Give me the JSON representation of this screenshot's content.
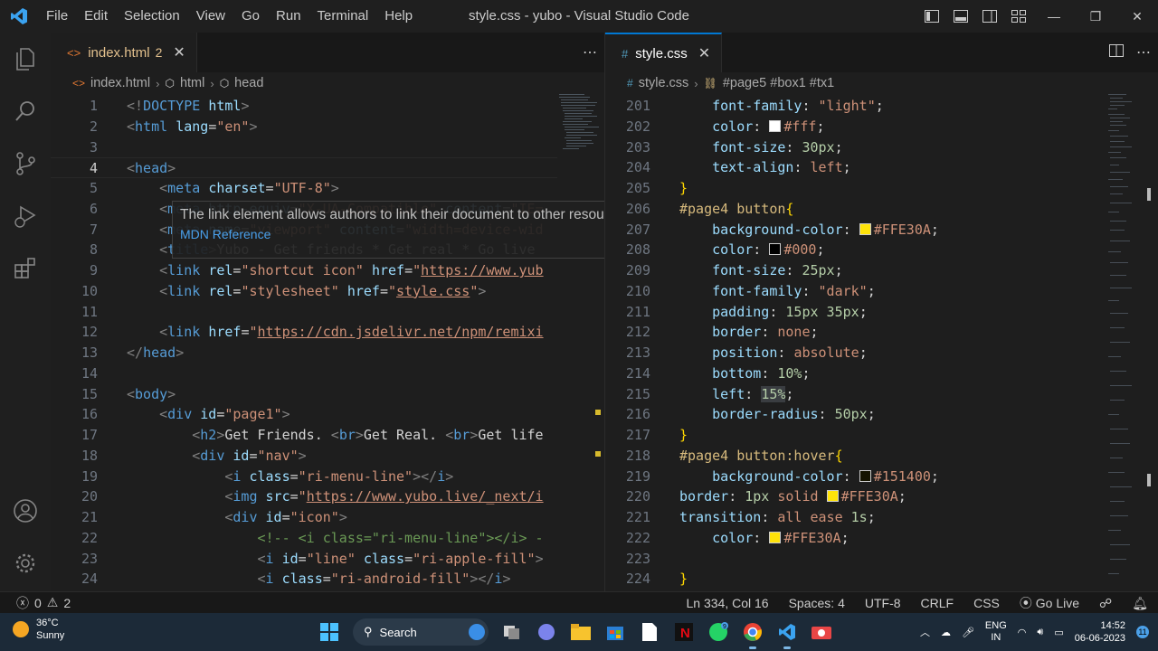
{
  "window": {
    "title": "style.css - yubo - Visual Studio Code",
    "menu": [
      "File",
      "Edit",
      "Selection",
      "View",
      "Go",
      "Run",
      "Terminal",
      "Help"
    ]
  },
  "activity": [
    "explorer-icon",
    "search-icon",
    "source-control-icon",
    "run-debug-icon",
    "extensions-icon",
    "account-icon",
    "settings-gear-icon"
  ],
  "left_editor": {
    "tab": {
      "label": "index.html",
      "problems": "2",
      "icon": "<>"
    },
    "breadcrumb": [
      "index.html",
      "html",
      "head"
    ],
    "lines": [
      {
        "n": "1",
        "html": "<span class='tag'>&lt;!</span><span class='tn'>DOCTYPE</span> <span class='an'>html</span><span class='tag'>&gt;</span>"
      },
      {
        "n": "2",
        "html": "<span class='tag'>&lt;</span><span class='tn'>html</span> <span class='an'>lang</span><span class='tx'>=</span><span class='av'>\"en\"</span><span class='tag'>&gt;</span>"
      },
      {
        "n": "3",
        "html": ""
      },
      {
        "n": "4",
        "html": "<span class='tag'>&lt;</span><span class='tn'>head</span><span class='tag'>&gt;</span>"
      },
      {
        "n": "5",
        "html": "    <span class='tag'>&lt;</span><span class='tn'>meta</span> <span class='an'>charset</span><span class='tx'>=</span><span class='av'>\"UTF-8\"</span><span class='tag'>&gt;</span>"
      },
      {
        "n": "6",
        "html": "    <span class='tag'>&lt;</span><span class='tn'>meta</span> <span class='an'>http-equiv</span><span class='tx'>=</span><span class='av'>\"X-UA-Compatible\"</span> <span class='an'>content</span><span class='tx'>=</span><span class='av'>\"IE=</span>"
      },
      {
        "n": "7",
        "html": "    <span class='tag'>&lt;</span><span class='tn'>meta</span> <span class='an'>name</span><span class='tx'>=</span><span class='av'>\"viewport\"</span> <span class='an'>content</span><span class='tx'>=</span><span class='av'>\"width=device-wid</span>"
      },
      {
        "n": "8",
        "html": "    <span class='tag'>&lt;</span><span class='tn'>title</span><span class='tag'>&gt;</span><span class='tx'>Yubo - Get friends * Get real * Go live</span>"
      },
      {
        "n": "9",
        "html": "    <span class='tag'>&lt;</span><span class='tn'>link</span> <span class='an'>rel</span><span class='tx'>=</span><span class='av'>\"shortcut icon\"</span> <span class='an'>href</span><span class='tx'>=</span><span class='av'>\"</span><span class='url'>https://www.yub</span>"
      },
      {
        "n": "10",
        "html": "    <span class='tag'>&lt;</span><span class='tn'>link</span> <span class='an'>rel</span><span class='tx'>=</span><span class='av'>\"stylesheet\"</span> <span class='an'>href</span><span class='tx'>=</span><span class='av'>\"</span><span class='url'>style.css</span><span class='av'>\"</span><span class='tag'>&gt;</span>"
      },
      {
        "n": "11",
        "html": ""
      },
      {
        "n": "12",
        "html": "    <span class='tag'>&lt;</span><span class='tn'>link</span> <span class='an'>href</span><span class='tx'>=</span><span class='av'>\"</span><span class='url'>https://cdn.jsdelivr.net/npm/remixi</span>"
      },
      {
        "n": "13",
        "html": "<span class='tag'>&lt;/</span><span class='tn'>head</span><span class='tag'>&gt;</span>"
      },
      {
        "n": "14",
        "html": ""
      },
      {
        "n": "15",
        "html": "<span class='tag'>&lt;</span><span class='tn'>body</span><span class='tag'>&gt;</span>"
      },
      {
        "n": "16",
        "html": "    <span class='tag'>&lt;</span><span class='tn'>div</span> <span class='an'>id</span><span class='tx'>=</span><span class='av'>\"page1\"</span><span class='tag'>&gt;</span>"
      },
      {
        "n": "17",
        "html": "        <span class='tag'>&lt;</span><span class='tn'>h2</span><span class='tag'>&gt;</span><span class='tx'>Get Friends. </span><span class='tag'>&lt;</span><span class='tn'>br</span><span class='tag'>&gt;</span><span class='tx'>Get Real. </span><span class='tag'>&lt;</span><span class='tn'>br</span><span class='tag'>&gt;</span><span class='tx'>Get life</span>"
      },
      {
        "n": "18",
        "html": "        <span class='tag'>&lt;</span><span class='tn'>div</span> <span class='an'>id</span><span class='tx'>=</span><span class='av'>\"nav\"</span><span class='tag'>&gt;</span>"
      },
      {
        "n": "19",
        "html": "            <span class='tag'>&lt;</span><span class='tn'>i</span> <span class='an'>class</span><span class='tx'>=</span><span class='av'>\"ri-menu-line\"</span><span class='tag'>&gt;&lt;/</span><span class='tn'>i</span><span class='tag'>&gt;</span>"
      },
      {
        "n": "20",
        "html": "            <span class='tag'>&lt;</span><span class='tn'>img</span> <span class='an'>src</span><span class='tx'>=</span><span class='av'>\"</span><span class='url'>https://www.yubo.live/_next/i</span>"
      },
      {
        "n": "21",
        "html": "            <span class='tag'>&lt;</span><span class='tn'>div</span> <span class='an'>id</span><span class='tx'>=</span><span class='av'>\"icon\"</span><span class='tag'>&gt;</span>"
      },
      {
        "n": "22",
        "html": "                <span class='cm'>&lt;!-- &lt;i class=\"ri-menu-line\"&gt;&lt;/i&gt; -</span>"
      },
      {
        "n": "23",
        "html": "                <span class='tag'>&lt;</span><span class='tn'>i</span> <span class='an'>id</span><span class='tx'>=</span><span class='av'>\"line\"</span> <span class='an'>class</span><span class='tx'>=</span><span class='av'>\"ri-apple-fill\"</span><span class='tag'>&gt;</span>"
      },
      {
        "n": "24",
        "html": "                <span class='tag'>&lt;</span><span class='tn'>i</span> <span class='an'>class</span><span class='tx'>=</span><span class='av'>\"ri-android-fill\"</span><span class='tag'>&gt;&lt;/</span><span class='tn'>i</span><span class='tag'>&gt;</span>"
      }
    ],
    "current_line": "4",
    "hover": {
      "text": "The link element allows authors to link their document to other resources.",
      "link": "MDN Reference"
    }
  },
  "right_editor": {
    "tab": {
      "label": "style.css",
      "icon": "#"
    },
    "breadcrumb": [
      "style.css",
      "#page5 #box1 #tx1"
    ],
    "lines": [
      {
        "n": "201",
        "html": "    <span class='pr'>font-family</span><span class='pn'>: </span><span class='vl'>\"light\"</span><span class='pn'>;</span>"
      },
      {
        "n": "202",
        "html": "    <span class='pr'>color</span><span class='pn'>: </span><span class='sw' style='background:#fff'></span><span class='vl'>#fff</span><span class='pn'>;</span>"
      },
      {
        "n": "203",
        "html": "    <span class='pr'>font-size</span><span class='pn'>: </span><span class='nm'>30px</span><span class='pn'>;</span>"
      },
      {
        "n": "204",
        "html": "    <span class='pr'>text-align</span><span class='pn'>: </span><span class='vl'>left</span><span class='pn'>;</span>"
      },
      {
        "n": "205",
        "html": "<span class='br'>}</span>"
      },
      {
        "n": "206",
        "html": "<span class='sel'>#page4 button</span><span class='br'>{</span>"
      },
      {
        "n": "207",
        "html": "    <span class='pr'>background-color</span><span class='pn'>: </span><span class='sw' style='background:#FFE30A'></span><span class='vl'>#FFE30A</span><span class='pn'>;</span>"
      },
      {
        "n": "208",
        "html": "    <span class='pr'>color</span><span class='pn'>: </span><span class='sw' style='background:#000'></span><span class='vl'>#000</span><span class='pn'>;</span>"
      },
      {
        "n": "209",
        "html": "    <span class='pr'>font-size</span><span class='pn'>: </span><span class='nm'>25px</span><span class='pn'>;</span>"
      },
      {
        "n": "210",
        "html": "    <span class='pr'>font-family</span><span class='pn'>: </span><span class='vl'>\"dark\"</span><span class='pn'>;</span>"
      },
      {
        "n": "211",
        "html": "    <span class='pr'>padding</span><span class='pn'>: </span><span class='nm'>15px 35px</span><span class='pn'>;</span>"
      },
      {
        "n": "212",
        "html": "    <span class='pr'>border</span><span class='pn'>: </span><span class='vl'>none</span><span class='pn'>;</span>"
      },
      {
        "n": "213",
        "html": "    <span class='pr'>position</span><span class='pn'>: </span><span class='vl'>absolute</span><span class='pn'>;</span>"
      },
      {
        "n": "214",
        "html": "    <span class='pr'>bottom</span><span class='pn'>: </span><span class='nm'>10%</span><span class='pn'>;</span>"
      },
      {
        "n": "215",
        "html": "    <span class='pr'>left</span><span class='pn'>: </span><span class='nm' style='background:#3a3d41'>15%</span><span class='pn'>;</span>"
      },
      {
        "n": "216",
        "html": "    <span class='pr'>border-radius</span><span class='pn'>: </span><span class='nm'>50px</span><span class='pn'>;</span>"
      },
      {
        "n": "217",
        "html": "<span class='br'>}</span>"
      },
      {
        "n": "218",
        "html": "<span class='sel'>#page4 button:hover</span><span class='br'>{</span>"
      },
      {
        "n": "219",
        "html": "    <span class='pr'>background-color</span><span class='pn'>: </span><span class='sw' style='background:#151400'></span><span class='vl'>#151400</span><span class='pn'>;</span>"
      },
      {
        "n": "220",
        "html": "<span class='pr'>border</span><span class='pn'>: </span><span class='nm'>1px</span> <span class='vl'>solid</span> <span class='sw' style='background:#FFE30A'></span><span class='vl'>#FFE30A</span><span class='pn'>;</span>"
      },
      {
        "n": "221",
        "html": "<span class='pr'>transition</span><span class='pn'>: </span><span class='vl'>all ease</span> <span class='nm'>1s</span><span class='pn'>;</span>"
      },
      {
        "n": "222",
        "html": "    <span class='pr'>color</span><span class='pn'>: </span><span class='sw' style='background:#FFE30A'></span><span class='vl'>#FFE30A</span><span class='pn'>;</span>"
      },
      {
        "n": "223",
        "html": ""
      },
      {
        "n": "224",
        "html": "<span class='br'>}</span>"
      }
    ]
  },
  "status": {
    "errors": "0",
    "warnings": "2",
    "position": "Ln 334, Col 16",
    "spaces": "Spaces: 4",
    "encoding": "UTF-8",
    "eol": "CRLF",
    "language": "CSS",
    "golive": "Go Live"
  },
  "taskbar": {
    "weather_temp": "36°C",
    "weather_text": "Sunny",
    "search": "Search",
    "lang_top": "ENG",
    "lang_bottom": "IN",
    "time": "14:52",
    "date": "06-06-2023",
    "notif_count": "11",
    "whatsapp_badge": "9"
  },
  "colors": {
    "accent": "#0078d4",
    "statusbar": "#181818",
    "taskbar": "#1c2a38"
  }
}
